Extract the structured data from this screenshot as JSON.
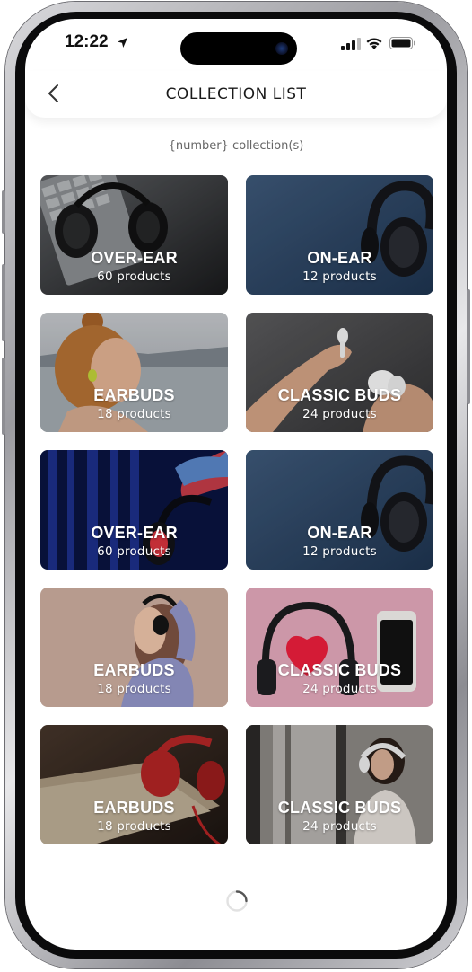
{
  "status_bar": {
    "time": "12:22"
  },
  "header": {
    "title": "COLLECTION LIST"
  },
  "subtitle": "{number} collection(s)",
  "collections": [
    {
      "title": "OVER-EAR",
      "count": "60 products"
    },
    {
      "title": "ON-EAR",
      "count": "12 products"
    },
    {
      "title": "EARBUDS",
      "count": "18 products"
    },
    {
      "title": "CLASSIC BUDS",
      "count": "24 products"
    },
    {
      "title": "OVER-EAR",
      "count": "60 products"
    },
    {
      "title": "ON-EAR",
      "count": "12 products"
    },
    {
      "title": "EARBUDS",
      "count": "18 products"
    },
    {
      "title": "CLASSIC BUDS",
      "count": "24 products"
    },
    {
      "title": "EARBUDS",
      "count": "18 products"
    },
    {
      "title": "CLASSIC BUDS",
      "count": "24 products"
    }
  ],
  "icons": {
    "back": "chevron-left-icon",
    "location": "location-arrow-icon",
    "signal": "signal-icon",
    "wifi": "wifi-icon",
    "battery": "battery-icon",
    "loading": "loading-spinner-icon"
  }
}
